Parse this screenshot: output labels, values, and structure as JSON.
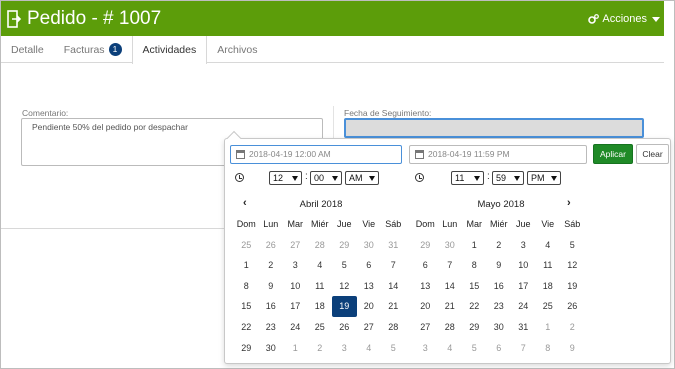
{
  "header": {
    "title": "Pedido - # 1007",
    "actions_label": "Acciones"
  },
  "tabs": [
    {
      "label": "Detalle",
      "badge": ""
    },
    {
      "label": "Facturas",
      "badge": "1"
    },
    {
      "label": "Actividades",
      "badge": ""
    },
    {
      "label": "Archivos",
      "badge": ""
    }
  ],
  "form": {
    "comment_label": "Comentario:",
    "comment_value": "Pendiente 50% del pedido por despachar",
    "follow_label": "Fecha de Seguimiento:",
    "follow_value": ""
  },
  "picker": {
    "start_value": "2018-04-19 12:00 AM",
    "end_value": "2018-04-19 11:59 PM",
    "apply_label": "Aplicar",
    "clear_label": "Clear",
    "start_time": {
      "hour": "12",
      "minute": "00",
      "ampm": "AM"
    },
    "end_time": {
      "hour": "11",
      "minute": "59",
      "ampm": "PM"
    },
    "colon": ":",
    "prev_arrow": "‹",
    "next_arrow": "›",
    "weekdays": [
      "Dom",
      "Lun",
      "Mar",
      "Miér",
      "Jue",
      "Vie",
      "Sáb"
    ],
    "left_month": {
      "title": "Abril 2018",
      "days": [
        [
          "25",
          "off"
        ],
        [
          "26",
          "off"
        ],
        [
          "27",
          "off"
        ],
        [
          "28",
          "off"
        ],
        [
          "29",
          "off"
        ],
        [
          "30",
          "off"
        ],
        [
          "31",
          "off"
        ],
        [
          "1",
          ""
        ],
        [
          "2",
          ""
        ],
        [
          "3",
          ""
        ],
        [
          "4",
          ""
        ],
        [
          "5",
          ""
        ],
        [
          "6",
          ""
        ],
        [
          "7",
          ""
        ],
        [
          "8",
          ""
        ],
        [
          "9",
          ""
        ],
        [
          "10",
          ""
        ],
        [
          "11",
          ""
        ],
        [
          "12",
          ""
        ],
        [
          "13",
          ""
        ],
        [
          "14",
          ""
        ],
        [
          "15",
          ""
        ],
        [
          "16",
          ""
        ],
        [
          "17",
          ""
        ],
        [
          "18",
          ""
        ],
        [
          "19",
          "sel"
        ],
        [
          "20",
          ""
        ],
        [
          "21",
          ""
        ],
        [
          "22",
          ""
        ],
        [
          "23",
          ""
        ],
        [
          "24",
          ""
        ],
        [
          "25",
          ""
        ],
        [
          "26",
          ""
        ],
        [
          "27",
          ""
        ],
        [
          "28",
          ""
        ],
        [
          "29",
          ""
        ],
        [
          "30",
          ""
        ],
        [
          "1",
          "off"
        ],
        [
          "2",
          "off"
        ],
        [
          "3",
          "off"
        ],
        [
          "4",
          "off"
        ],
        [
          "5",
          "off"
        ]
      ]
    },
    "right_month": {
      "title": "Mayo 2018",
      "days": [
        [
          "29",
          "off"
        ],
        [
          "30",
          "off"
        ],
        [
          "1",
          ""
        ],
        [
          "2",
          ""
        ],
        [
          "3",
          ""
        ],
        [
          "4",
          ""
        ],
        [
          "5",
          ""
        ],
        [
          "6",
          ""
        ],
        [
          "7",
          ""
        ],
        [
          "8",
          ""
        ],
        [
          "9",
          ""
        ],
        [
          "10",
          ""
        ],
        [
          "11",
          ""
        ],
        [
          "12",
          ""
        ],
        [
          "13",
          ""
        ],
        [
          "14",
          ""
        ],
        [
          "15",
          ""
        ],
        [
          "16",
          ""
        ],
        [
          "17",
          ""
        ],
        [
          "18",
          ""
        ],
        [
          "19",
          ""
        ],
        [
          "20",
          ""
        ],
        [
          "21",
          ""
        ],
        [
          "22",
          ""
        ],
        [
          "23",
          ""
        ],
        [
          "24",
          ""
        ],
        [
          "25",
          ""
        ],
        [
          "26",
          ""
        ],
        [
          "27",
          ""
        ],
        [
          "28",
          ""
        ],
        [
          "29",
          ""
        ],
        [
          "30",
          ""
        ],
        [
          "31",
          ""
        ],
        [
          "1",
          "off"
        ],
        [
          "2",
          "off"
        ],
        [
          "3",
          "off"
        ],
        [
          "4",
          "off"
        ],
        [
          "5",
          "off"
        ],
        [
          "6",
          "off"
        ],
        [
          "7",
          "off"
        ],
        [
          "8",
          "off"
        ],
        [
          "9",
          "off"
        ]
      ]
    }
  },
  "colors": {
    "header_green": "#5c9d0a",
    "apply_green": "#1f8a27",
    "selected_blue": "#0b3f7a",
    "badge_blue": "#0b3f7a"
  },
  "icons": {
    "title": "door-exit-icon",
    "actions": "gears-icon",
    "calendar": "calendar-icon",
    "clock": "clock-icon"
  }
}
